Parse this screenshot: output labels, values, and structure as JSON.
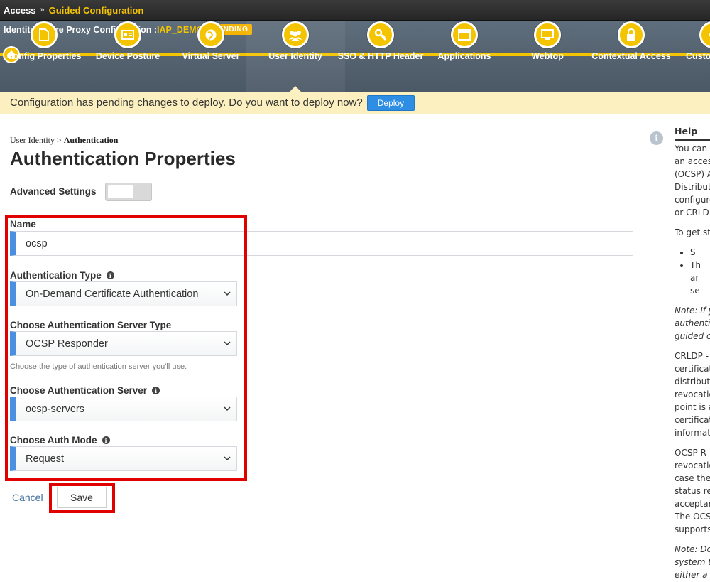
{
  "topbar": {
    "section": "Access",
    "separator": "»",
    "page": "Guided Configuration"
  },
  "config": {
    "title_prefix": "Identity Aware Proxy Configuration :",
    "name": "IAP_DEMO",
    "status": "PENDING"
  },
  "wizard": {
    "steps": [
      {
        "label": "Config Properties",
        "icon": "document-icon"
      },
      {
        "label": "Device Posture",
        "icon": "id-card-icon"
      },
      {
        "label": "Virtual Server",
        "icon": "globe-icon"
      },
      {
        "label": "User Identity",
        "icon": "users-icon",
        "active": true
      },
      {
        "label": "SSO & HTTP Header",
        "icon": "key-icon"
      },
      {
        "label": "Applications",
        "icon": "window-icon"
      },
      {
        "label": "Webtop",
        "icon": "monitor-icon"
      },
      {
        "label": "Contextual Access",
        "icon": "lock-icon"
      },
      {
        "label": "Custo",
        "icon": "gear-icon"
      }
    ]
  },
  "pending": {
    "message": "Configuration has pending changes to deploy. Do you want to deploy now?",
    "deploy_label": "Deploy"
  },
  "breadcrumb": {
    "parent": "User Identity",
    "separator": " > ",
    "current": "Authentication"
  },
  "page_title": "Authentication Properties",
  "advanced": {
    "label": "Advanced Settings",
    "enabled": false
  },
  "form": {
    "name": {
      "label": "Name",
      "value": "ocsp"
    },
    "auth_type": {
      "label": "Authentication Type",
      "value": "On-Demand Certificate Authentication"
    },
    "server_type": {
      "label": "Choose Authentication Server Type",
      "value": "OCSP Responder",
      "hint": "Choose the type of authentication server you'll use."
    },
    "server": {
      "label": "Choose Authentication Server",
      "value": "ocsp-servers"
    },
    "auth_mode": {
      "label": "Choose Auth Mode",
      "value": "Request"
    }
  },
  "actions": {
    "cancel_label": "Cancel",
    "save_label": "Save"
  },
  "help": {
    "title": "Help",
    "lines1": [
      "You can",
      "an acces",
      "(OCSP) A",
      "Distributi",
      "configure",
      "or CRLD"
    ],
    "intro": "To get st",
    "bullets": [
      "S",
      "Th",
      "ar",
      "se"
    ],
    "note1": [
      "Note: If y",
      "authentic",
      "guided c"
    ],
    "crldp": [
      "CRLDP -",
      "certificat",
      "distributi",
      "revocatio",
      "point is a",
      "certificat",
      "informati"
    ],
    "ocsp": [
      "OCSP R",
      "revocatio",
      "case the",
      "status re",
      "acceptar",
      "The OCS",
      "supports"
    ],
    "note2": [
      "Note: Do",
      "system t",
      "either a s"
    ]
  },
  "colors": {
    "accent": "#f5c400",
    "field_bar": "#4a8fe0",
    "deploy": "#2d8ee4",
    "highlight": "#e00000"
  }
}
